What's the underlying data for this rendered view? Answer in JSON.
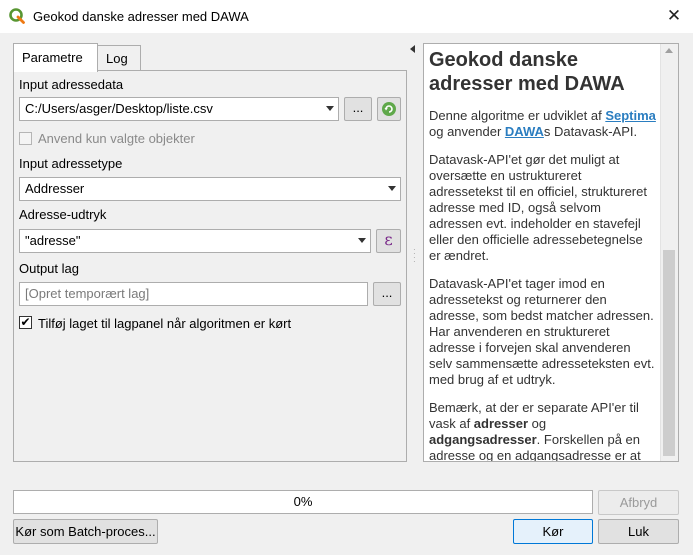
{
  "window": {
    "title": "Geokod danske adresser med DAWA",
    "close_glyph": "✕"
  },
  "tabs": [
    {
      "label": "Parametre",
      "active": true
    },
    {
      "label": "Log",
      "active": false
    }
  ],
  "params": {
    "input_label": "Input adressedata",
    "input_value": "C:/Users/asger/Desktop/liste.csv",
    "browse_glyph": "...",
    "selected_only_label": "Anvend kun valgte objekter",
    "type_label": "Input adressetype",
    "type_value": "Addresser",
    "expr_label": "Adresse-udtryk",
    "expr_value": "\"adresse\"",
    "expr_glyph": "ε",
    "output_label": "Output lag",
    "output_placeholder": "[Opret temporært lag]",
    "add_layer_label": "Tilføj laget til lagpanel når algoritmen er kørt",
    "add_layer_checked": true
  },
  "help": {
    "title": "Geokod danske adresser med DAWA",
    "p1_a": "Denne algoritme er udviklet af ",
    "p1_link1": "Septima",
    "p1_b": " og anvender ",
    "p1_link2": "DAWA",
    "p1_c": "s Datavask-API.",
    "p2": "Datavask-API'et gør det muligt at oversætte en ustruktureret adressetekst til en officiel, struktureret adresse med ID, også selvom adressen evt. indeholder en stavefejl eller den officielle adressebetegnelse er ændret.",
    "p3": "Datavask-API'et tager imod en adressetekst og returnerer den adresse, som bedst matcher adressen. Har anvenderen en struktureret adresse i forvejen skal anvenderen selv sammensætte adresseteksten evt. med brug af et udtryk.",
    "p4_a": "Bemærk, at der er separate API'er til vask af ",
    "p4_b1": "adresser",
    "p4_c": " og ",
    "p4_b2": "adgangsadresser",
    "p4_d": ". Forskellen på en adresse og en adgangsadresse er at adressen rummer eventuel etage- og/"
  },
  "progress": {
    "value": 0,
    "label": "0%"
  },
  "buttons": {
    "cancel": "Afbryd",
    "batch": "Kør som Batch-proces...",
    "run": "Kør",
    "close": "Luk"
  },
  "colors": {
    "link": "#2a7dc0",
    "primary_border": "#0078d7",
    "qgis_green": "#589632"
  }
}
